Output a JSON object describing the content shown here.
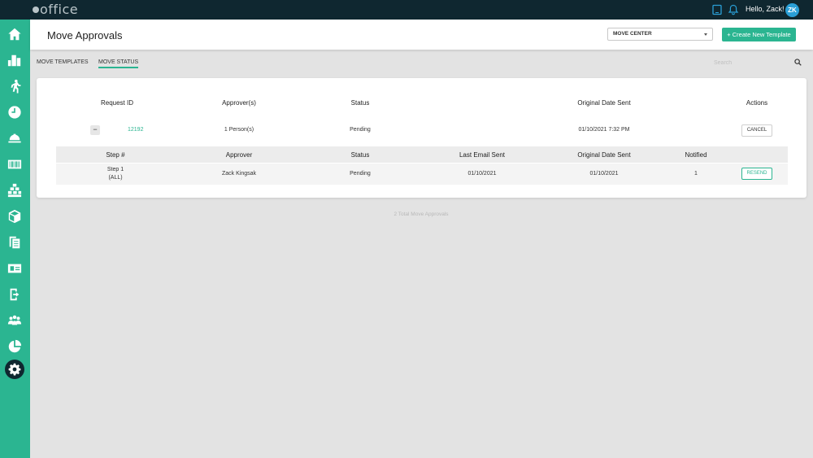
{
  "app": {
    "logo": "office",
    "greeting": "Hello, Zack!",
    "avatar_initials": "ZK",
    "brand_color": "#2bb591",
    "topbar_color": "#0f2730"
  },
  "header": {
    "title": "Move Approvals",
    "select_value": "MOVE CENTER",
    "create_button": "+ Create New Template"
  },
  "tabs": [
    "MOVE TEMPLATES",
    "MOVE STATUS"
  ],
  "active_tab": "MOVE STATUS",
  "search": {
    "placeholder": "Search"
  },
  "sidebar": {
    "icons": [
      "home-icon",
      "building-icon",
      "person-walking-icon",
      "clock-icon",
      "bell-service-icon",
      "barcode-icon",
      "stacked-boxes-icon",
      "box-icon",
      "documents-icon",
      "id-card-icon",
      "door-exit-icon",
      "people-icon",
      "pie-chart-icon",
      "gear-icon"
    ],
    "active": "gear-icon"
  },
  "table": {
    "columns": [
      "Request ID",
      "Approver(s)",
      "Status",
      "Original Date Sent",
      "Actions"
    ],
    "rows": [
      {
        "expand_symbol": "−",
        "request_id": "12192",
        "approvers": "1 Person(s)",
        "status": "Pending",
        "original_date_sent": "01/10/2021 7:32 PM",
        "action": "CANCEL",
        "steps_columns": [
          "Step #",
          "Approver",
          "Status",
          "Last Email Sent",
          "Original Date Sent",
          "Notified"
        ],
        "steps": [
          {
            "step_line1": "Step 1",
            "step_line2": "(ALL)",
            "approver": "Zack Kingsak",
            "status": "Pending",
            "last_email_sent": "01/10/2021",
            "original_date_sent": "01/10/2021",
            "notified": "1",
            "action": "RESEND"
          }
        ]
      }
    ]
  },
  "footer": {
    "total": "2 Total Move Approvals"
  }
}
